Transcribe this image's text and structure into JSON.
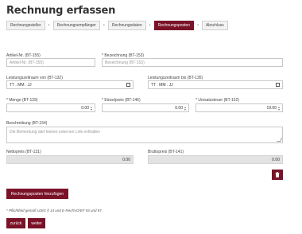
{
  "page": {
    "title": "Rechnung erfassen"
  },
  "steps": [
    {
      "label": "Rechnungssteller"
    },
    {
      "label": "Rechnungsempfänger"
    },
    {
      "label": "Rechnungsdaten"
    },
    {
      "label": "Rechnungsposten"
    },
    {
      "label": "Abschluss"
    }
  ],
  "steps_separator": "›",
  "form": {
    "article_no": {
      "label": "Artikel-Nr. (BT-155)",
      "placeholder": "Artikel-Nr. (BT-155)"
    },
    "designation": {
      "label": "* Bezeichnung (BT-153)",
      "placeholder": "Bezeichnung (BT-153)"
    },
    "period_from": {
      "label": "Leistungszeitraum von (BT-132)",
      "value": "TT . MM . JJ"
    },
    "period_to": {
      "label": "Leistungszeitraum bis (BT-135)",
      "value": "TT . MM . JJ"
    },
    "quantity": {
      "label": "* Menge (BT-129)",
      "value": "0.00"
    },
    "unit_price": {
      "label": "* Einzelpreis (BT-146)",
      "value": "0.00"
    },
    "vat": {
      "label": "* Umsatzsteuer (BT-152)",
      "value": "19.00"
    },
    "description": {
      "label": "Beschreibung (BT-154)",
      "placeholder": "Die Bemerkung darf keinen externen Link enthalten"
    },
    "net": {
      "label": "Nettopreis (BT-131)",
      "value": "0.00"
    },
    "gross": {
      "label": "Bruttopreis (BT-141)",
      "value": "0.00"
    }
  },
  "buttons": {
    "delete_icon": "trash-icon",
    "add_item": "Rechnungsposten hinzufügen",
    "back": "zurück",
    "next": "weiter"
  },
  "note": "* Pflichtfeld gemäß UStG § 14 und E-RechVO/EF 93 und 97.",
  "colors": {
    "accent": "#7a1228",
    "readonly_bg": "#e3e3e3"
  }
}
